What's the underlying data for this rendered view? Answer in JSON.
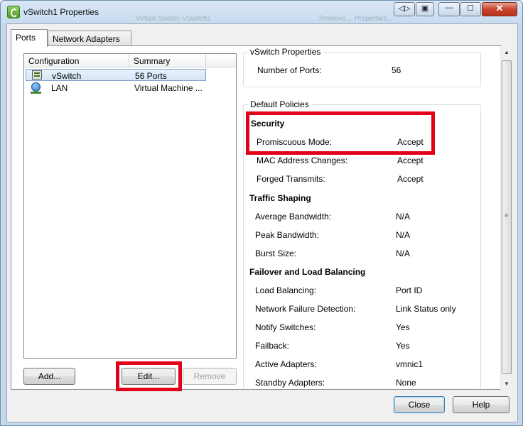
{
  "window": {
    "title": "vSwitch1 Properties",
    "background_faint_1": "Virtual Switch: vSwitch1",
    "background_faint_2": "Remove...",
    "background_faint_3": "Properties..."
  },
  "title_buttons": {
    "restore_glyph": "◁▷",
    "pin_glyph": "▣",
    "minimize_glyph": "—",
    "maximize_glyph": "☐",
    "close_glyph": "✕"
  },
  "tabs": [
    {
      "label": "Ports",
      "active": true
    },
    {
      "label": "Network Adapters",
      "active": false
    }
  ],
  "ports_list": {
    "columns": [
      "Configuration",
      "Summary"
    ],
    "rows": [
      {
        "icon": "switch-icon",
        "configuration": "vSwitch",
        "summary": "56 Ports",
        "selected": true
      },
      {
        "icon": "lan-globe-icon",
        "configuration": "LAN",
        "summary": "Virtual Machine ..."
      }
    ]
  },
  "list_buttons": {
    "add": "Add...",
    "edit": "Edit...",
    "remove": "Remove"
  },
  "vswitch_properties": {
    "group_title": "vSwitch Properties",
    "number_of_ports_label": "Number of Ports:",
    "number_of_ports_value": "56"
  },
  "default_policies": {
    "group_title": "Default Policies",
    "security": {
      "title": "Security",
      "promiscuous_mode_label": "Promiscuous Mode:",
      "promiscuous_mode_value": "Accept",
      "mac_address_changes_label": "MAC Address Changes:",
      "mac_address_changes_value": "Accept",
      "forged_transmits_label": "Forged Transmits:",
      "forged_transmits_value": "Accept"
    },
    "traffic_shaping": {
      "title": "Traffic Shaping",
      "average_bandwidth_label": "Average Bandwidth:",
      "average_bandwidth_value": "N/A",
      "peak_bandwidth_label": "Peak Bandwidth:",
      "peak_bandwidth_value": "N/A",
      "burst_size_label": "Burst Size:",
      "burst_size_value": "N/A"
    },
    "failover": {
      "title": "Failover and Load Balancing",
      "load_balancing_label": "Load Balancing:",
      "load_balancing_value": "Port ID",
      "network_failure_detection_label": "Network Failure Detection:",
      "network_failure_detection_value": "Link Status only",
      "notify_switches_label": "Notify Switches:",
      "notify_switches_value": "Yes",
      "failback_label": "Failback:",
      "failback_value": "Yes",
      "active_adapters_label": "Active Adapters:",
      "active_adapters_value": "vmnic1",
      "standby_adapters_label": "Standby Adapters:",
      "standby_adapters_value": "None"
    }
  },
  "scrollbar": {
    "up_glyph": "▲",
    "down_glyph": "▼",
    "grip_glyph": "≡"
  },
  "dialog_buttons": {
    "close": "Close",
    "help": "Help"
  },
  "colors": {
    "highlight": "#e2001a",
    "selection": "#d5e5f7"
  }
}
